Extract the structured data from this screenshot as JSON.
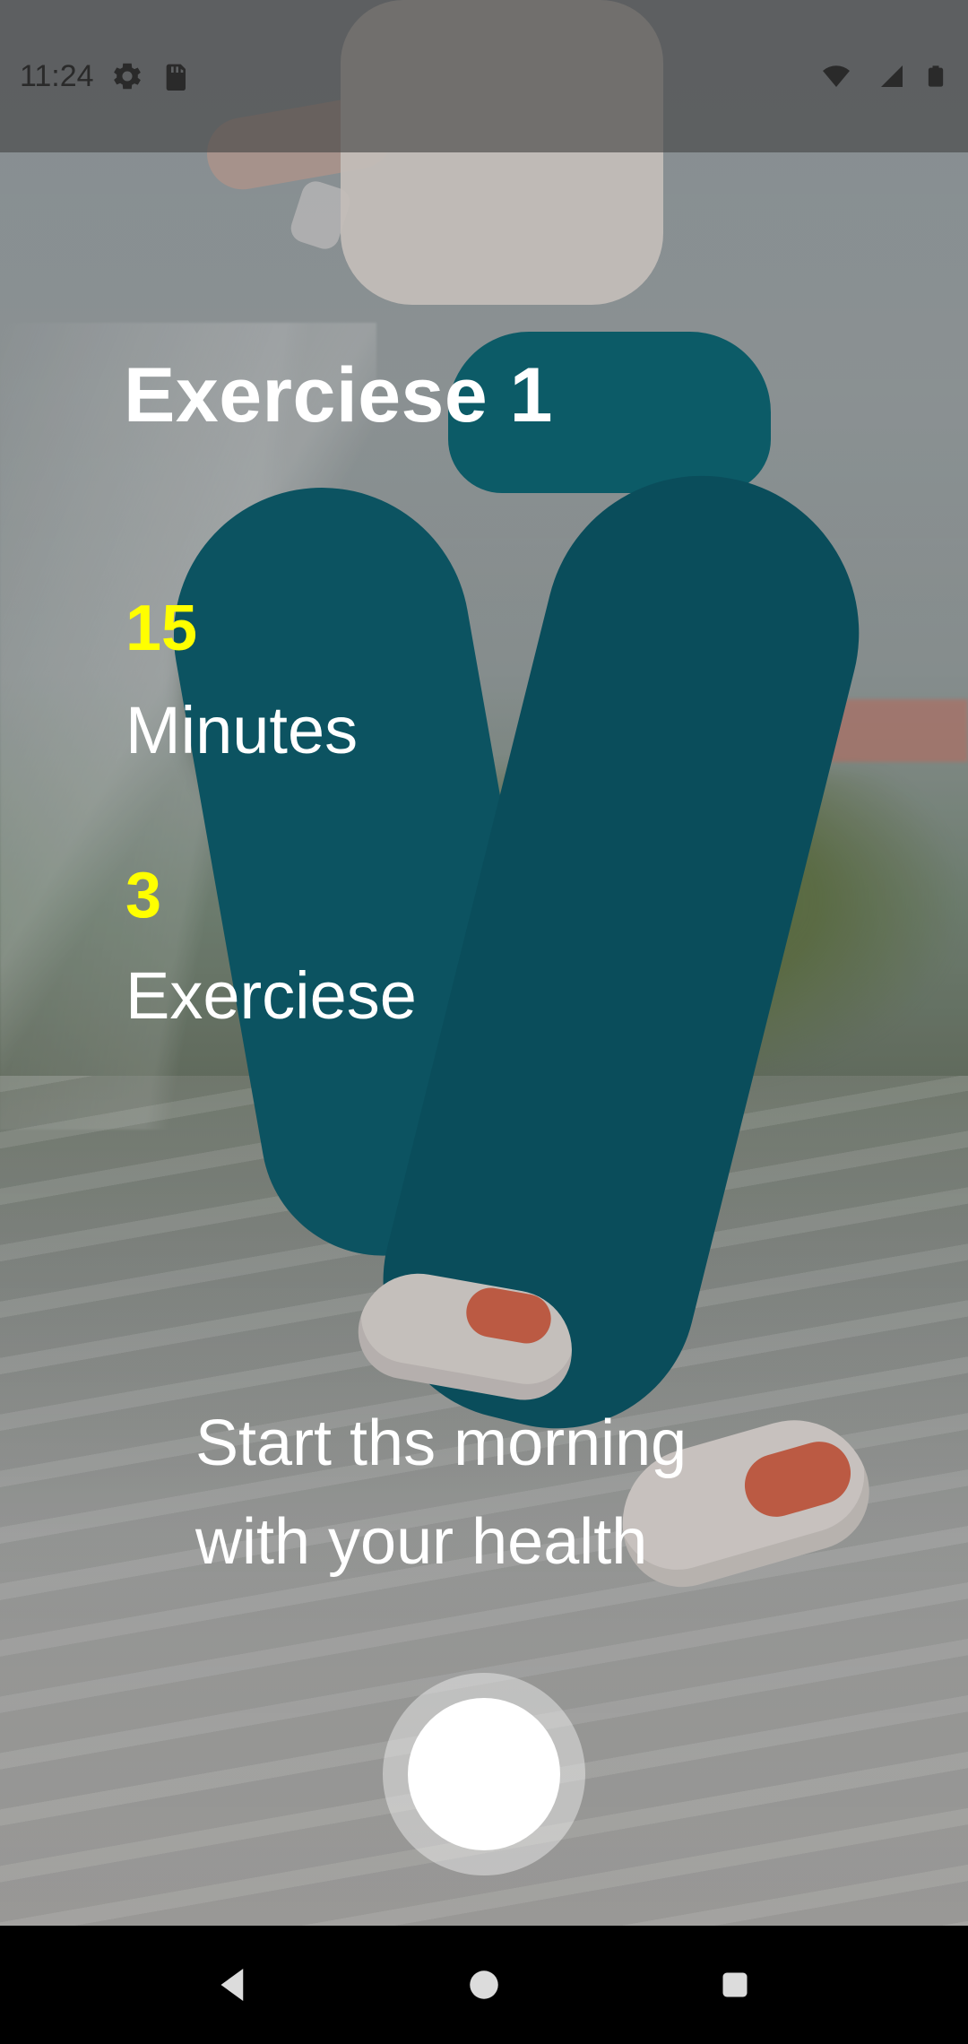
{
  "status_bar": {
    "time": "11:24",
    "icons": [
      "gear-icon",
      "sd-card-icon",
      "wifi-icon",
      "signal-icon",
      "battery-icon"
    ]
  },
  "workout": {
    "title": "Exerciese 1",
    "stats": [
      {
        "value": "15",
        "label": "Minutes"
      },
      {
        "value": "3",
        "label": "Exerciese"
      }
    ],
    "tagline_lines": [
      "Start ths morning",
      "with your health"
    ]
  },
  "colors": {
    "accent": "#FFFF00",
    "text": "#FFFFFF",
    "pants": "#0F6677",
    "shoe_accent": "#E46E52"
  },
  "nav": {
    "buttons": [
      "back-icon",
      "home-icon",
      "recents-icon"
    ]
  }
}
